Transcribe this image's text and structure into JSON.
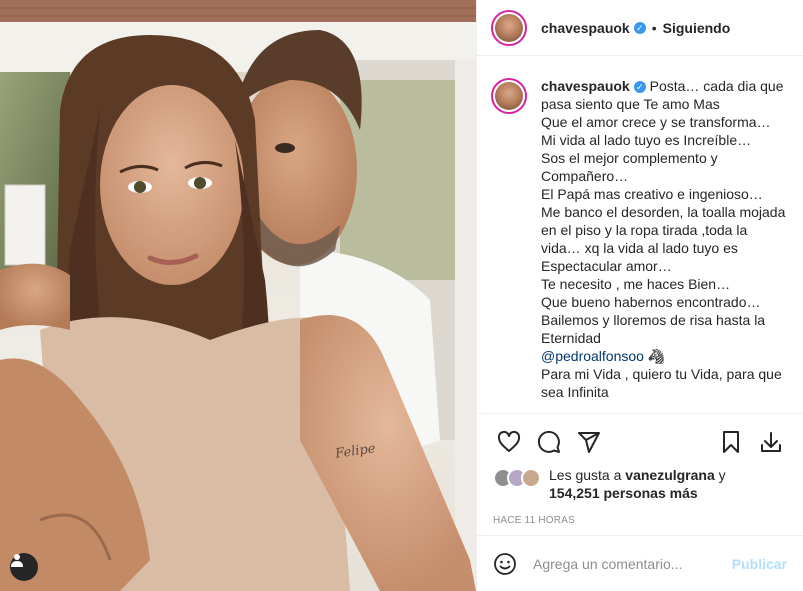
{
  "photo": {
    "tattoo_text": "Felipe"
  },
  "post": {
    "username": "chavespauok",
    "verified_mark": "✓",
    "separator": "•",
    "follow_status": "Siguiendo"
  },
  "caption": {
    "username": "chavespauok",
    "lines": [
      "Posta… cada dia que",
      "pasa siento que Te amo Mas",
      "Que el amor crece y se transforma…",
      "Mi vida al lado tuyo es Increíble…",
      "Sos el mejor complemento y",
      "Compañero…",
      "El Papá mas creativo e ingenioso…",
      "Me banco el desorden, la toalla mojada",
      "en el piso y la ropa tirada ,toda la",
      "vida… xq la vida al lado tuyo es",
      "Espectacular amor…",
      "Te necesito , me haces Bien…",
      "Que bueno habernos encontrado…",
      "Bailemos y lloremos de risa hasta la",
      "Eternidad"
    ],
    "mention": "@pedroalfonsoo",
    "mention_emoji": "🦓",
    "last_lines": [
      "Para mi Vida , quiero tu Vida, para que",
      "sea Infinita"
    ]
  },
  "likes": {
    "prefix": "Les gusta a",
    "user": "vanezulgrana",
    "connector": "y",
    "count_text": "154,251 personas más"
  },
  "timestamp": "HACE 11 HORAS",
  "comment": {
    "placeholder": "Agrega un comentario...",
    "publish_label": "Publicar"
  },
  "icons": {
    "like": "heart-icon",
    "comment": "comment-icon",
    "share": "share-icon",
    "save": "bookmark-icon",
    "download": "download-icon",
    "emoji": "emoji-icon",
    "tag": "user-tag-icon"
  },
  "colors": {
    "text": "#262626",
    "muted": "#8e8e8e",
    "link": "#00376b",
    "verified": "#3897f0",
    "publish_disabled": "#b2dffc"
  }
}
